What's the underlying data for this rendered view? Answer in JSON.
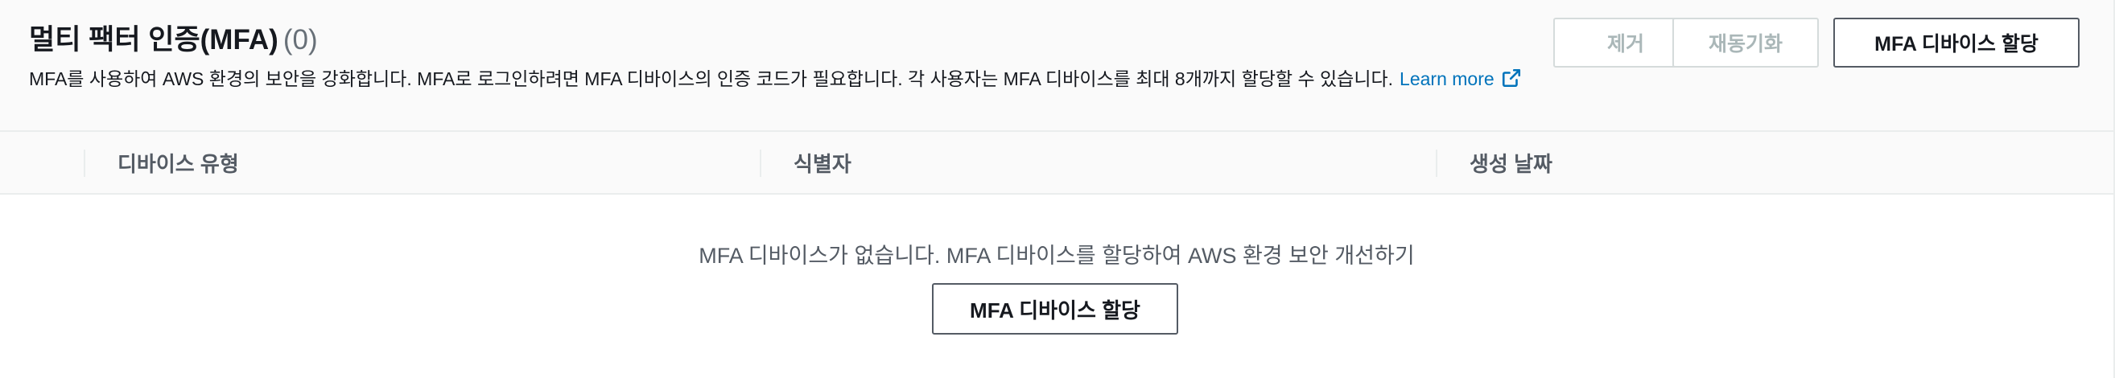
{
  "header": {
    "title": "멀티 팩터 인증(MFA)",
    "count": "(0)",
    "description": "MFA를 사용하여 AWS 환경의 보안을 강화합니다. MFA로 로그인하려면 MFA 디바이스의 인증 코드가 필요합니다. 각 사용자는 MFA 디바이스를 최대 8개까지 할당할 수 있습니다.",
    "learn_more": "Learn more",
    "learn_more_icon": "external-link-icon"
  },
  "actions": {
    "remove_label": "제거",
    "resync_label": "재동기화",
    "assign_label": "MFA 디바이스 할당"
  },
  "table": {
    "columns": [
      "디바이스 유형",
      "식별자",
      "생성 날짜"
    ],
    "rows": []
  },
  "empty_state": {
    "message": "MFA 디바이스가 없습니다. MFA 디바이스를 할당하여 AWS 환경 보안 개선하기",
    "button_label": "MFA 디바이스 할당"
  },
  "colors": {
    "link": "#0073bb",
    "text": "#16191f",
    "muted": "#545b64",
    "disabled": "#aab7b8",
    "header_bg": "#fafafa",
    "border": "#eaeded"
  }
}
